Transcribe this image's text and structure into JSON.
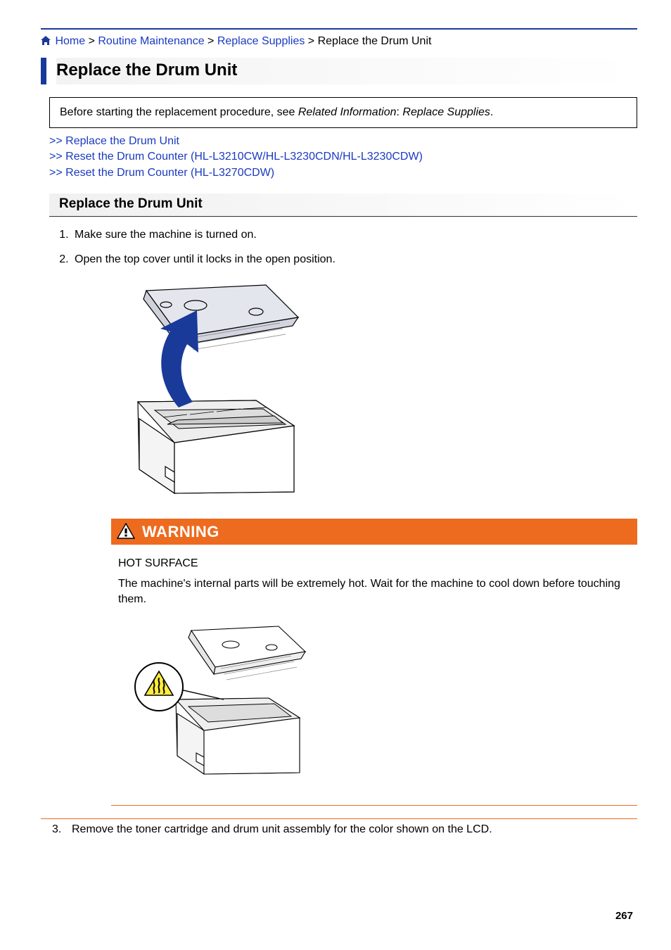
{
  "breadcrumb": {
    "home": "Home",
    "routine": "Routine Maintenance",
    "replace_supplies": "Replace Supplies",
    "current": "Replace the Drum Unit"
  },
  "page_title": "Replace the Drum Unit",
  "note": {
    "pre": "Before starting the replacement procedure, see ",
    "ital1": "Related Information",
    "mid": ": ",
    "ital2": "Replace Supplies",
    "post": "."
  },
  "toc": {
    "l1": "Replace the Drum Unit",
    "l2": "Reset the Drum Counter (HL-L3210CW/HL-L3230CDN/HL-L3230CDW)",
    "l3": "Reset the Drum Counter (HL-L3270CDW)"
  },
  "subhead": "Replace the Drum Unit",
  "steps": {
    "s1": "Make sure the machine is turned on.",
    "s2": "Open the top cover until it locks in the open position.",
    "s3": "Remove the toner cartridge and drum unit assembly for the color shown on the LCD."
  },
  "warning": {
    "label": "WARNING",
    "subtitle": "HOT SURFACE",
    "body": "The machine's internal parts will be extremely hot. Wait for the machine to cool down before touching them."
  },
  "page_number": "267",
  "colors": {
    "accent": "#1a3a99",
    "link": "#1a3ac0",
    "warning": "#ed6b1e"
  }
}
